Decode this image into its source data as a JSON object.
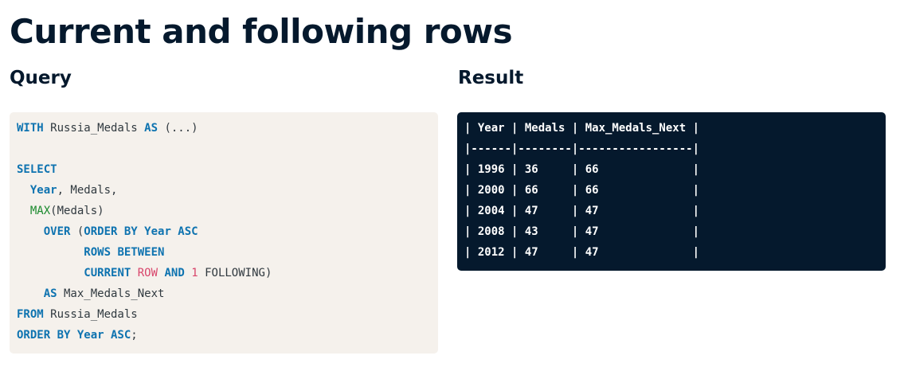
{
  "title": "Current and following rows",
  "query_label": "Query",
  "result_label": "Result",
  "query_lines": [
    [
      {
        "t": "WITH",
        "c": "kw"
      },
      {
        "t": " Russia_Medals ",
        "c": ""
      },
      {
        "t": "AS",
        "c": "kw"
      },
      {
        "t": " (...)",
        "c": ""
      }
    ],
    [],
    [
      {
        "t": "SELECT",
        "c": "kw"
      }
    ],
    [
      {
        "t": "  ",
        "c": ""
      },
      {
        "t": "Year",
        "c": "kw"
      },
      {
        "t": ", Medals,",
        "c": ""
      }
    ],
    [
      {
        "t": "  ",
        "c": ""
      },
      {
        "t": "MAX",
        "c": "fn"
      },
      {
        "t": "(Medals)",
        "c": ""
      }
    ],
    [
      {
        "t": "    ",
        "c": ""
      },
      {
        "t": "OVER",
        "c": "kw"
      },
      {
        "t": " (",
        "c": ""
      },
      {
        "t": "ORDER BY Year ASC",
        "c": "kw"
      }
    ],
    [
      {
        "t": "          ",
        "c": ""
      },
      {
        "t": "ROWS BETWEEN",
        "c": "kw"
      }
    ],
    [
      {
        "t": "          ",
        "c": ""
      },
      {
        "t": "CURRENT",
        "c": "kw"
      },
      {
        "t": " ",
        "c": ""
      },
      {
        "t": "ROW",
        "c": "red"
      },
      {
        "t": " ",
        "c": ""
      },
      {
        "t": "AND",
        "c": "kw"
      },
      {
        "t": " ",
        "c": ""
      },
      {
        "t": "1",
        "c": "red"
      },
      {
        "t": " FOLLOWING)",
        "c": ""
      }
    ],
    [
      {
        "t": "    ",
        "c": ""
      },
      {
        "t": "AS",
        "c": "kw"
      },
      {
        "t": " Max_Medals_Next",
        "c": ""
      }
    ],
    [
      {
        "t": "FROM",
        "c": "kw"
      },
      {
        "t": " Russia_Medals",
        "c": ""
      }
    ],
    [
      {
        "t": "ORDER BY Year ASC",
        "c": "kw"
      },
      {
        "t": ";",
        "c": ""
      }
    ]
  ],
  "result_lines": [
    "| Year | Medals | Max_Medals_Next |",
    "|------|--------|-----------------|",
    "| 1996 | 36     | 66              |",
    "| 2000 | 66     | 66              |",
    "| 2004 | 47     | 47              |",
    "| 2008 | 43     | 47              |",
    "| 2012 | 47     | 47              |"
  ],
  "colors": {
    "keyword": "#0e73b0",
    "function": "#1b8a2e",
    "literal": "#d8456b",
    "query_bg": "#f5f1ec",
    "result_bg": "#05192d",
    "heading": "#05192d"
  }
}
